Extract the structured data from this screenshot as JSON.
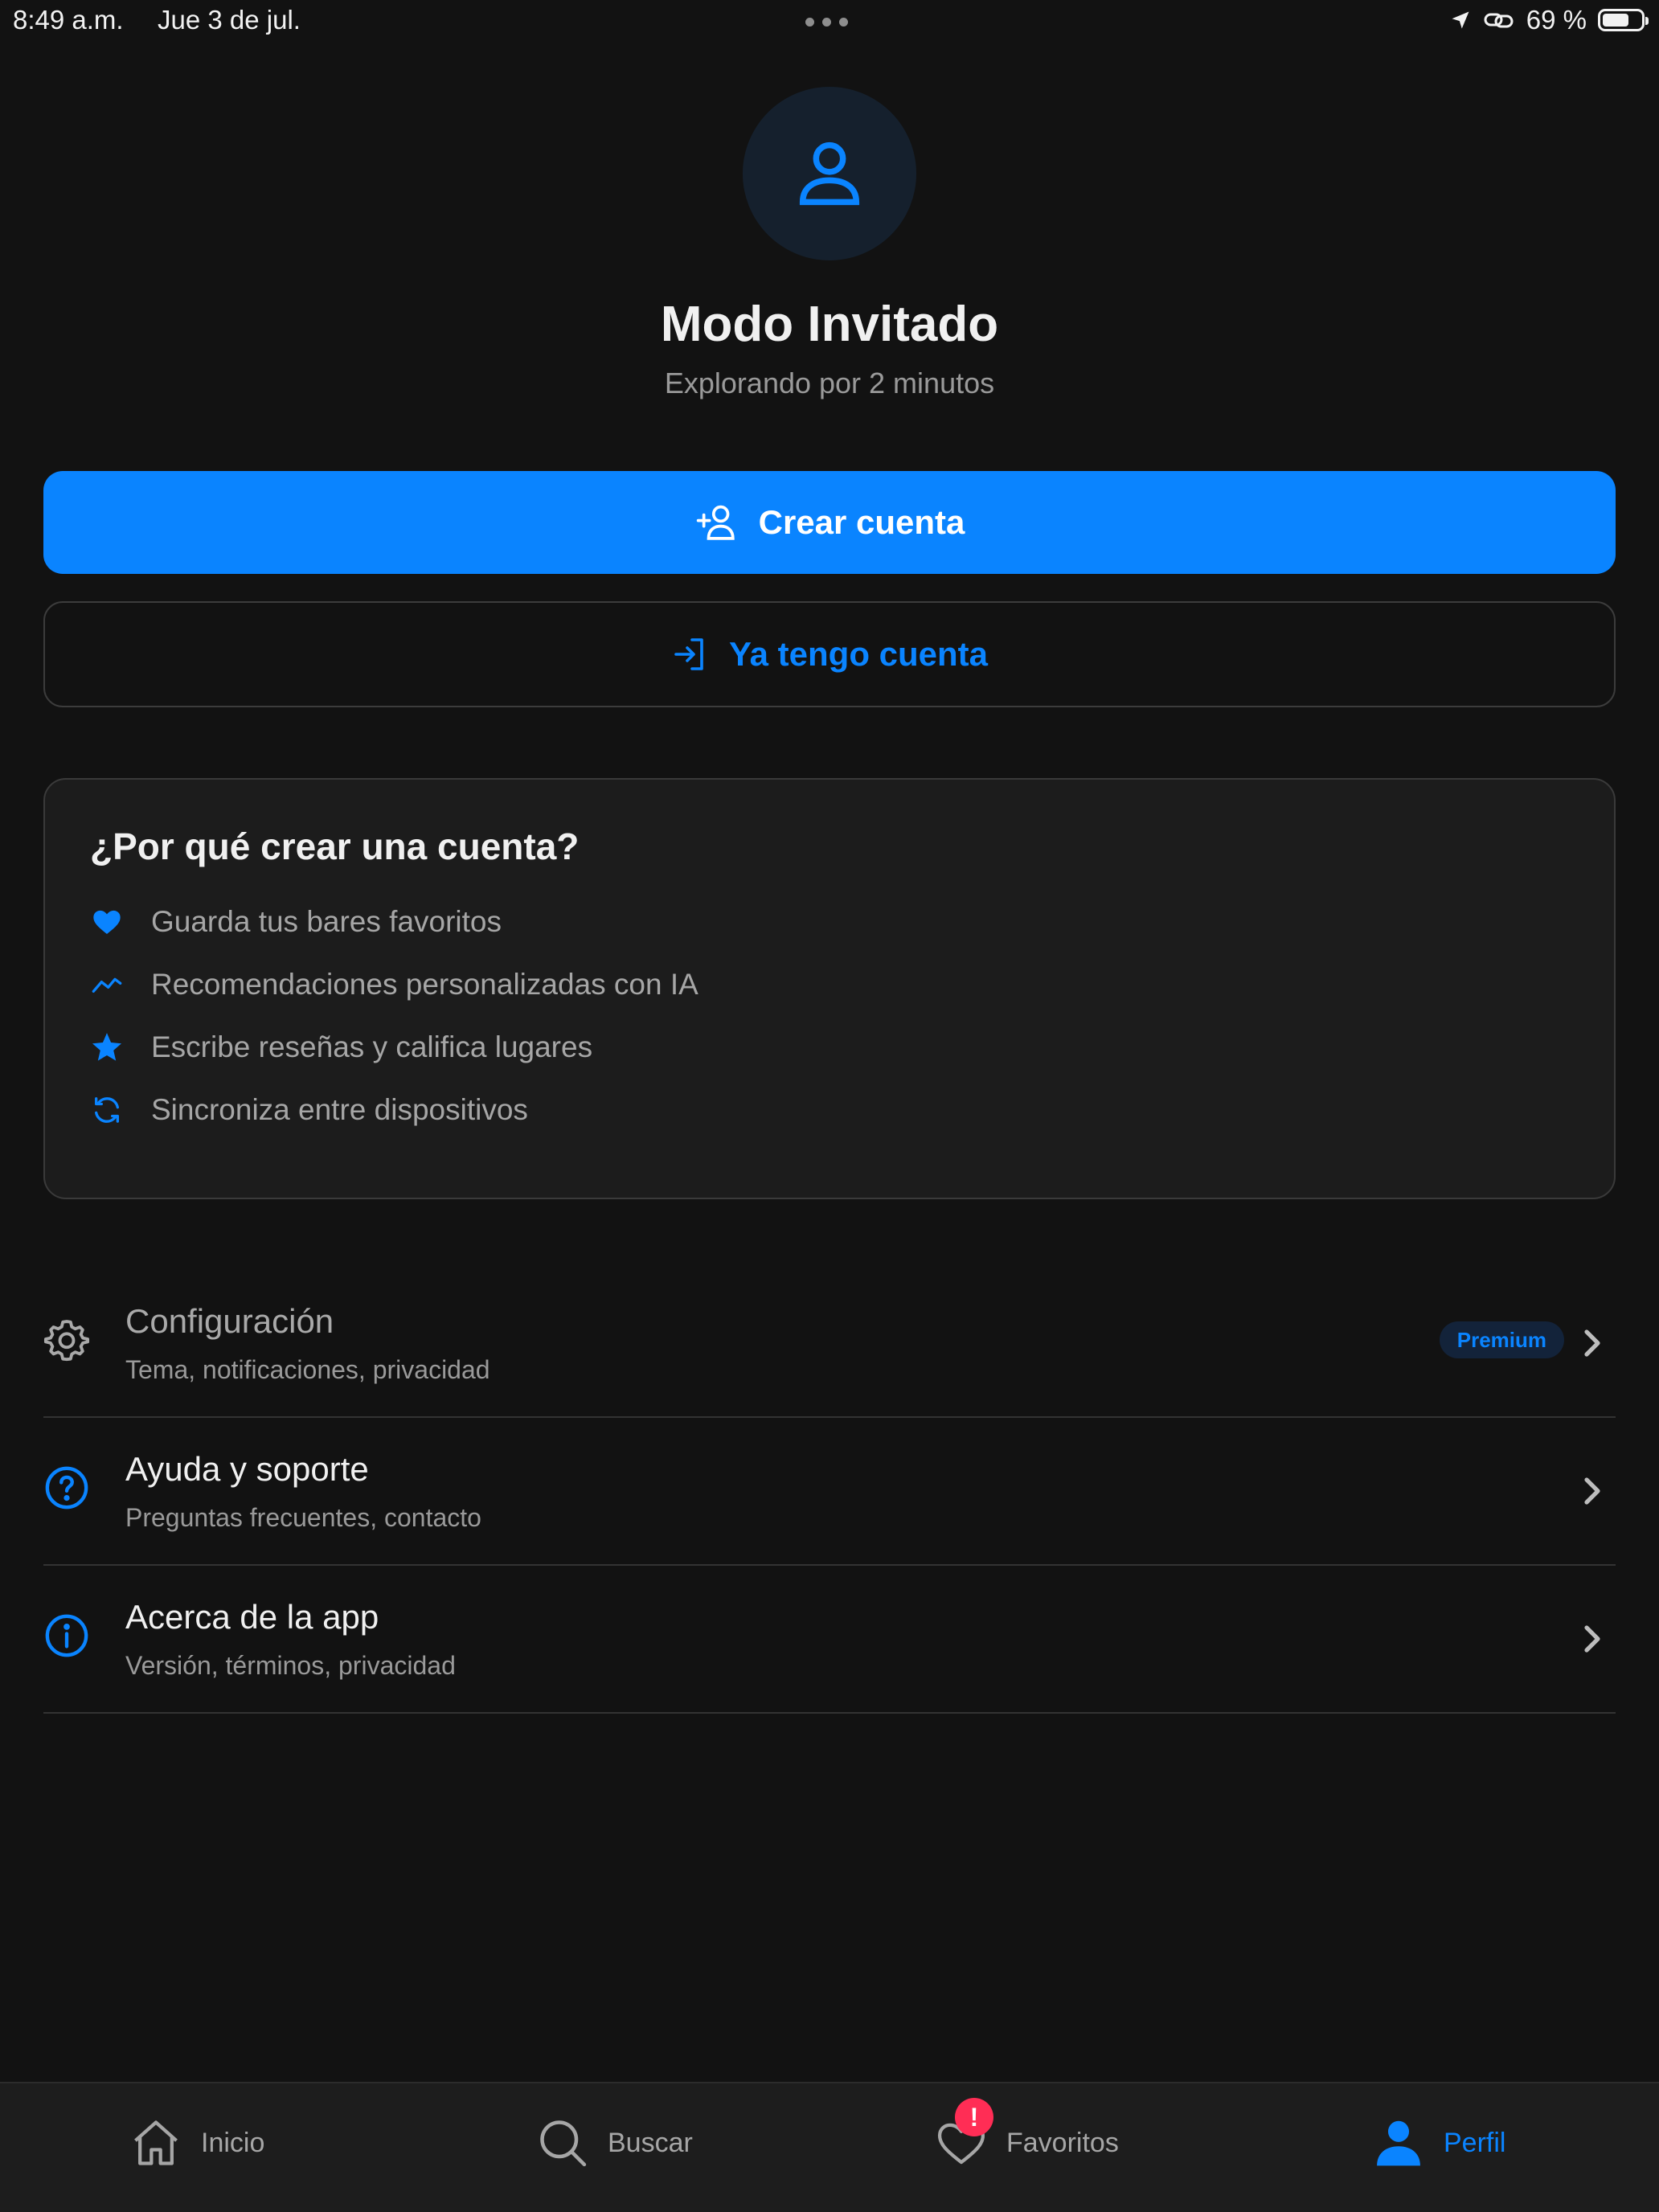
{
  "status_bar": {
    "time": "8:49 a.m.",
    "date": "Jue 3 de jul.",
    "battery_text": "69 %",
    "battery_level": 0.69
  },
  "profile": {
    "title": "Modo Invitado",
    "subtitle": "Explorando por 2 minutos"
  },
  "actions": {
    "create_account": "Crear cuenta",
    "have_account": "Ya tengo cuenta"
  },
  "benefits": {
    "title": "¿Por qué crear una cuenta?",
    "items": [
      {
        "label": "Guarda tus bares favoritos",
        "icon": "heart-icon"
      },
      {
        "label": "Recomendaciones personalizadas con IA",
        "icon": "trend-icon"
      },
      {
        "label": "Escribe reseñas y califica lugares",
        "icon": "star-icon"
      },
      {
        "label": "Sincroniza entre dispositivos",
        "icon": "sync-icon"
      }
    ]
  },
  "menu": [
    {
      "label": "Configuración",
      "desc": "Tema, notificaciones, privacidad",
      "badge": "Premium",
      "icon": "gear-icon"
    },
    {
      "label": "Ayuda y soporte",
      "desc": "Preguntas frecuentes, contacto",
      "icon": "help-icon"
    },
    {
      "label": "Acerca de la app",
      "desc": "Versión, términos, privacidad",
      "icon": "info-icon"
    }
  ],
  "tabs": [
    {
      "label": "Inicio",
      "icon": "home-icon"
    },
    {
      "label": "Buscar",
      "icon": "search-icon"
    },
    {
      "label": "Favoritos",
      "icon": "heart-outline-icon",
      "badge": "!"
    },
    {
      "label": "Perfil",
      "icon": "person-icon",
      "active": true
    }
  ],
  "colors": {
    "accent": "#0a84ff",
    "background": "#121212",
    "card": "#1c1c1c",
    "notification": "#ff2d55"
  }
}
